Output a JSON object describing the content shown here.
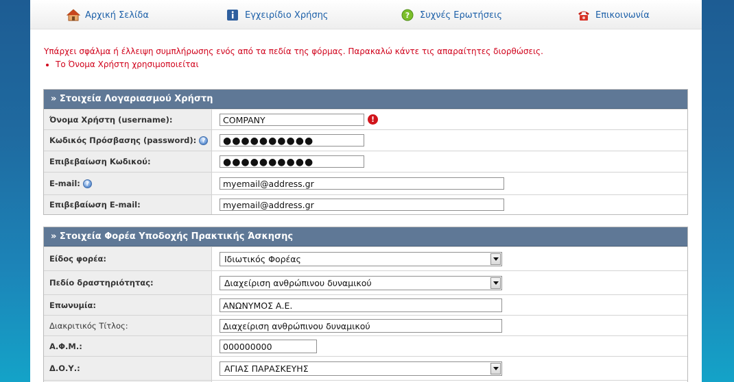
{
  "nav": {
    "items": [
      {
        "label": "Αρχική Σελίδα",
        "icon": "home-icon"
      },
      {
        "label": "Εγχειρίδιο Χρήσης",
        "icon": "info-icon"
      },
      {
        "label": "Συχνές Ερωτήσεις",
        "icon": "help-icon"
      },
      {
        "label": "Επικοινωνία",
        "icon": "phone-icon"
      }
    ]
  },
  "errors": {
    "message": "Υπάρχει σφάλμα ή έλλειψη συμπλήρωσης ενός από τα πεδία της φόρμας. Παρακαλώ κάντε τις απαραίτητες διορθώσεις.",
    "items": [
      "Το Όνομα Χρήστη χρησιμοποιείται"
    ]
  },
  "account": {
    "title": "» Στοιχεία Λογαριασμού Χρήστη",
    "username_label": "Όνομα Χρήστη (username):",
    "username_value": "COMPANY",
    "password_label": "Κωδικός Πρόσβασης (password):",
    "password_value": "●●●●●●●●●●",
    "confirm_label": "Επιβεβαίωση Κωδικού:",
    "confirm_value": "●●●●●●●●●●",
    "email_label": "E-mail:",
    "email_value": "myemail@address.gr",
    "email_confirm_label": "Επιβεβαίωση E-mail:",
    "email_confirm_value": "myemail@address.gr"
  },
  "org": {
    "title": "» Στοιχεία Φορέα Υποδοχής Πρακτικής Άσκησης",
    "type_label": "Είδος φορέα:",
    "type_value": "Ιδιωτικός Φορέας",
    "field_label": "Πεδίο δραστηριότητας:",
    "field_value": "Διαχείριση ανθρώπινου δυναμικού",
    "name_label": "Επωνυμία:",
    "name_value": "ΑΝΩΝΥΜΟΣ Α.Ε.",
    "trade_label": "Διακριτικός Τίτλος:",
    "trade_value": "Διαχείριση ανθρώπινου δυναμικού",
    "afm_label": "Α.Φ.Μ.:",
    "afm_value": "000000000",
    "doy_label": "Δ.Ο.Υ.:",
    "doy_value": "ΑΓΙΑΣ ΠΑΡΑΣΚΕΥΗΣ"
  }
}
